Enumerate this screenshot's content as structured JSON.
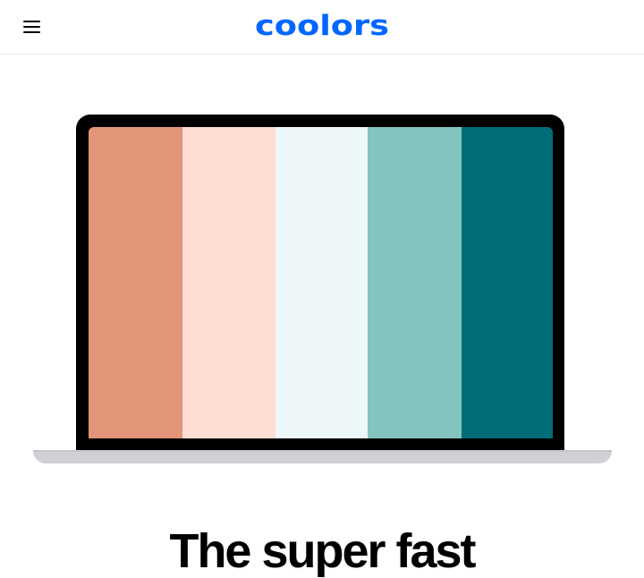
{
  "header": {
    "menu_icon": "hamburger-menu-icon",
    "logo_text": "coolors",
    "logo_color": "#0066ff"
  },
  "hero": {
    "palette": [
      {
        "name": "swatch-1",
        "color": "#e29578"
      },
      {
        "name": "swatch-2",
        "color": "#ffddd2"
      },
      {
        "name": "swatch-3",
        "color": "#edf6f9"
      },
      {
        "name": "swatch-4",
        "color": "#83c5be"
      },
      {
        "name": "swatch-5",
        "color": "#006d77"
      }
    ],
    "headline": "The super fast"
  }
}
